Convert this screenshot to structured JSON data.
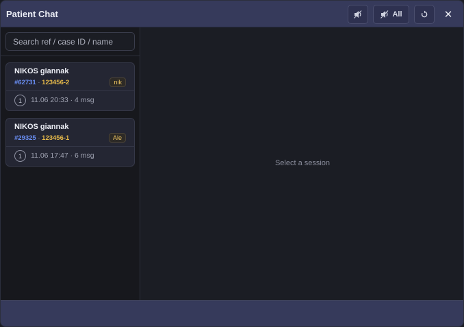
{
  "window": {
    "title": "Patient Chat"
  },
  "toolbar": {
    "notify_icon": "speaker-icon",
    "notify_all_label": "All",
    "refresh_icon": "refresh-icon",
    "close_label": "✕"
  },
  "search": {
    "placeholder": "Search ref / case ID / name",
    "value": ""
  },
  "sessions": [
    {
      "name": "NIKOS giannak",
      "ref": "#62731",
      "separator": "·",
      "case_id": "123456-2",
      "badge": "nik",
      "count": "1",
      "meta": "11.06 20:33 · 4 msg"
    },
    {
      "name": "NIKOS giannak",
      "ref": "#29325",
      "separator": "·",
      "case_id": "123456-1",
      "badge": "Ale",
      "count": "1",
      "meta": "11.06 17:47 · 6 msg"
    }
  ],
  "main": {
    "empty_text": "Select a session"
  },
  "colors": {
    "titlebar": "#363a5b",
    "ref": "#6a8ff5",
    "case": "#e6b94a"
  }
}
